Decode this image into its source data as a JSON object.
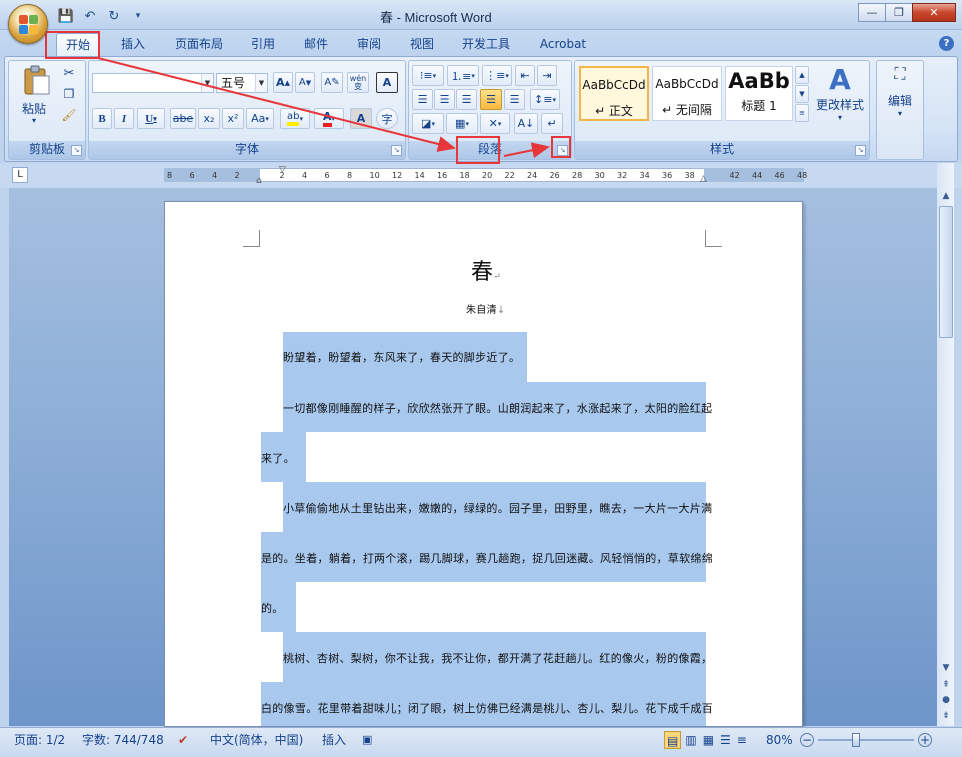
{
  "titlebar": {
    "title": "春 - Microsoft Word",
    "minimize": "—",
    "restore": "❐",
    "close": "✕"
  },
  "quick_access": {
    "save": "💾",
    "undo": "↶",
    "redo": "↻",
    "more": "▾"
  },
  "tabs": [
    {
      "label": "开始"
    },
    {
      "label": "插入"
    },
    {
      "label": "页面布局"
    },
    {
      "label": "引用"
    },
    {
      "label": "邮件"
    },
    {
      "label": "审阅"
    },
    {
      "label": "视图"
    },
    {
      "label": "开发工具"
    },
    {
      "label": "Acrobat"
    }
  ],
  "ribbon": {
    "clipboard": {
      "label": "剪贴板",
      "paste": "粘贴",
      "paste_arrow": "▾"
    },
    "font": {
      "label": "字体",
      "font_name": "",
      "font_size": "五号",
      "bold": "B",
      "italic": "I",
      "underline": "U",
      "strike": "abe",
      "sub": "x₂",
      "sup": "x²",
      "case": "Aa",
      "grow": "A",
      "shrink": "A",
      "wen": "wén",
      "char_border": "A",
      "enclose": "字",
      "char_shade": "A"
    },
    "paragraph": {
      "label": "段落"
    },
    "styles": {
      "label": "样式",
      "items": [
        {
          "preview": "AaBbCcDd",
          "name": "↵ 正文"
        },
        {
          "preview": "AaBbCcDd",
          "name": "↵ 无间隔"
        },
        {
          "preview": "AaBb",
          "name": "标题 1"
        }
      ],
      "change": "更改样式"
    },
    "editing": {
      "label": "编辑"
    }
  },
  "ruler": {
    "ticks": [
      "8",
      "6",
      "4",
      "2",
      "",
      "2",
      "4",
      "6",
      "8",
      "10",
      "12",
      "14",
      "16",
      "18",
      "20",
      "22",
      "24",
      "26",
      "28",
      "30",
      "32",
      "34",
      "36",
      "38",
      "",
      "42",
      "44",
      "46",
      "48"
    ]
  },
  "document": {
    "title": "春",
    "author": "朱自清",
    "lines": [
      "盼望着，盼望着，东风来了，春天的脚步近了。",
      "一切都像刚睡醒的样子，欣欣然张开了眼。山朗润起来了，水涨起来了，太阳的脸红起",
      "来了。",
      "小草偷偷地从土里钻出来，嫩嫩的，绿绿的。园子里，田野里，瞧去，一大片一大片满",
      "是的。坐着，躺着，打两个滚，踢几脚球，赛几趟跑，捉几回迷藏。风轻悄悄的，草软绵绵",
      "的。",
      "桃树、杏树、梨树，你不让我，我不让你，都开满了花赶趟儿。红的像火，粉的像霞，",
      "白的像雪。花里带着甜味儿；闭了眼，树上仿佛已经满是桃儿、杏儿、梨儿。花下成千成百"
    ]
  },
  "status": {
    "page": "页面: 1/2",
    "words": "字数: 744/748",
    "language": "中文(简体，中国)",
    "mode": "插入",
    "zoom": "80%"
  }
}
